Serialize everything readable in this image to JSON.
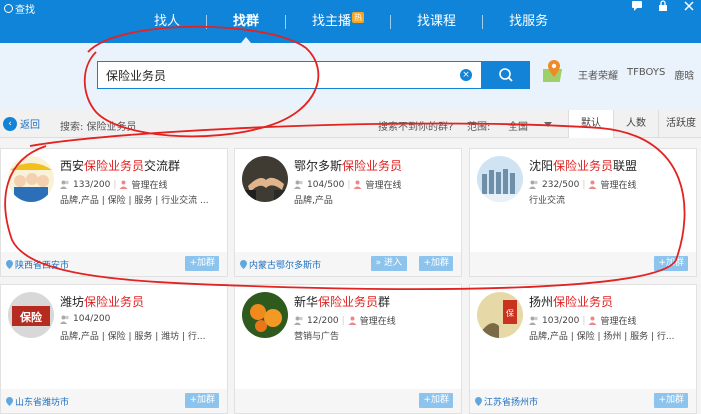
{
  "app": {
    "title": "查找"
  },
  "nav": {
    "items": [
      {
        "label": "找人",
        "active": false
      },
      {
        "label": "找群",
        "active": true
      },
      {
        "label": "找主播",
        "badge": "热",
        "active": false
      },
      {
        "label": "找课程",
        "active": false
      },
      {
        "label": "找服务",
        "active": false
      }
    ]
  },
  "search": {
    "value": "保险业务员",
    "hot_links": [
      "王者荣耀",
      "TFBOYS",
      "鹿晗"
    ]
  },
  "filter": {
    "back_label": "返回",
    "summary": "搜索: 保险业务员",
    "cant_find": "搜索不到你的群?",
    "range_label": "范围:",
    "range_value": "全国",
    "sort_tabs": [
      "默认",
      "人数",
      "活跃度"
    ]
  },
  "cards": [
    {
      "name_prefix": "西安",
      "name_highlight": "保险业务员",
      "name_suffix": "交流群",
      "members": "133/200",
      "manager": "管理在线",
      "tags": "品牌,产品 | 保险 | 服务 | 行业交流 ...",
      "location": "陕西省西安市",
      "join_label": "+加群"
    },
    {
      "name_prefix": "鄂尔多斯",
      "name_highlight": "保险业务员",
      "name_suffix": "",
      "members": "104/500",
      "manager": "管理在线",
      "tags": "品牌,产品",
      "location": "内蒙古鄂尔多斯市",
      "enter_label": "» 进入",
      "join_label": "+加群"
    },
    {
      "name_prefix": "沈阳",
      "name_highlight": "保险业务员",
      "name_suffix": "联盟",
      "members": "232/500",
      "manager": "管理在线",
      "tags": "行业交流",
      "location": "",
      "join_label": "+加群"
    },
    {
      "name_prefix": "潍坊",
      "name_highlight": "保险业务员",
      "name_suffix": "",
      "members": "104/200",
      "manager": "",
      "tags": "品牌,产品 | 保险 | 服务 | 潍坊 | 行...",
      "location": "山东省潍坊市",
      "join_label": "+加群"
    },
    {
      "name_prefix": "新华",
      "name_highlight": "保险业务员",
      "name_suffix": "群",
      "members": "12/200",
      "manager": "管理在线",
      "tags": "营销与广告",
      "location": "",
      "join_label": "+加群"
    },
    {
      "name_prefix": "扬州",
      "name_highlight": "保险业务员",
      "name_suffix": "",
      "members": "103/200",
      "manager": "管理在线",
      "tags": "品牌,产品 | 保险 | 扬州 | 服务 | 行...",
      "location": "江苏省扬州市",
      "join_label": "+加群"
    }
  ],
  "colors": {
    "header": "#0f84d8",
    "accent": "#1283d6",
    "highlight": "#e02020",
    "annotation": "#e32222"
  },
  "icons": [
    "logo-icon",
    "search-icon",
    "clear-icon",
    "map-pin-icon",
    "back-arrow-icon",
    "members-icon",
    "manager-icon",
    "location-icon",
    "dropdown-icon"
  ]
}
